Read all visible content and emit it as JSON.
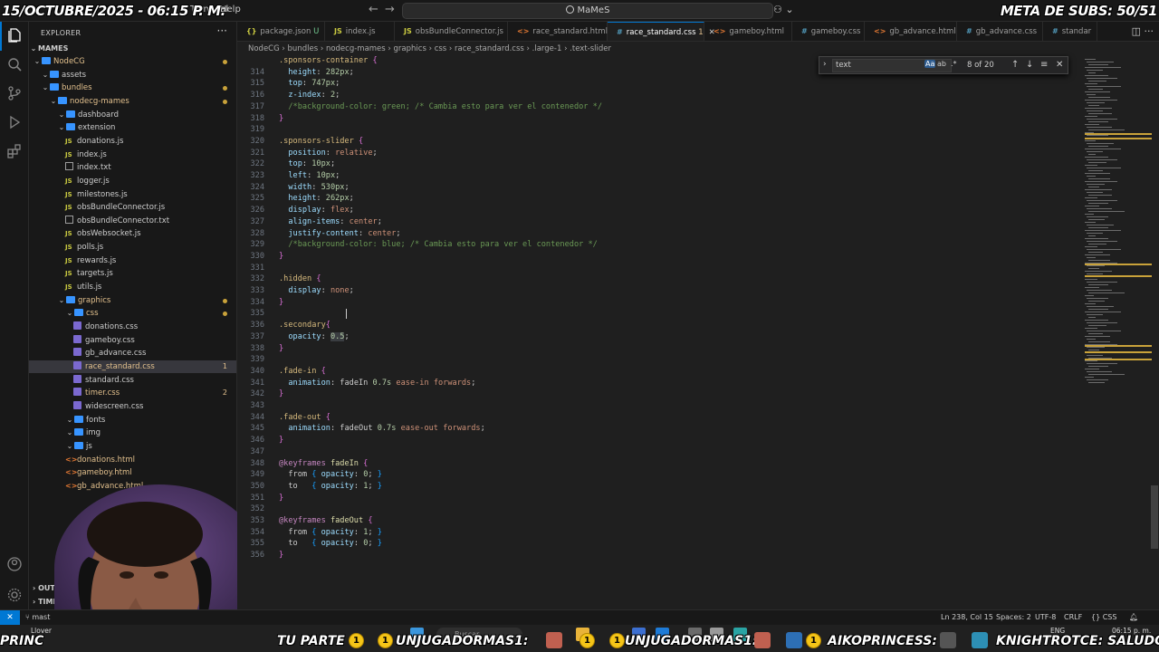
{
  "overlay": {
    "date": "15/OCTUBRE/2025 - 06:15 P. M.",
    "goal": "META DE SUBS: 50/51"
  },
  "menubar": {
    "terminal": "Terminal",
    "help": "Help"
  },
  "command_center": {
    "text": "MaMeS"
  },
  "sidebar": {
    "title": "EXPLORER",
    "section": "MAMES",
    "items": [
      {
        "label": "NodeCG",
        "type": "folder",
        "indent": 0
      },
      {
        "label": "assets",
        "type": "folder",
        "indent": 1
      },
      {
        "label": "bundles",
        "type": "folder",
        "indent": 1
      },
      {
        "label": "nodecg-mames",
        "type": "folder",
        "indent": 2
      },
      {
        "label": "dashboard",
        "type": "folder",
        "indent": 3
      },
      {
        "label": "extension",
        "type": "folder",
        "indent": 3
      },
      {
        "label": "donations.js",
        "type": "js",
        "indent": 4
      },
      {
        "label": "index.js",
        "type": "js",
        "indent": 4
      },
      {
        "label": "index.txt",
        "type": "txt",
        "indent": 4
      },
      {
        "label": "logger.js",
        "type": "js",
        "indent": 4
      },
      {
        "label": "milestones.js",
        "type": "js",
        "indent": 4
      },
      {
        "label": "obsBundleConnector.js",
        "type": "js",
        "indent": 4
      },
      {
        "label": "obsBundleConnector.txt",
        "type": "txt",
        "indent": 4
      },
      {
        "label": "obsWebsocket.js",
        "type": "js",
        "indent": 4
      },
      {
        "label": "polls.js",
        "type": "js",
        "indent": 4
      },
      {
        "label": "rewards.js",
        "type": "js",
        "indent": 4
      },
      {
        "label": "targets.js",
        "type": "js",
        "indent": 4
      },
      {
        "label": "utils.js",
        "type": "js",
        "indent": 4
      },
      {
        "label": "graphics",
        "type": "folder",
        "indent": 3
      },
      {
        "label": "css",
        "type": "folder",
        "indent": 4
      },
      {
        "label": "donations.css",
        "type": "css",
        "indent": 5
      },
      {
        "label": "gameboy.css",
        "type": "css",
        "indent": 5
      },
      {
        "label": "gb_advance.css",
        "type": "css",
        "indent": 5
      },
      {
        "label": "race_standard.css",
        "type": "css",
        "indent": 5,
        "badge": "1"
      },
      {
        "label": "standard.css",
        "type": "css",
        "indent": 5
      },
      {
        "label": "timer.css",
        "type": "css",
        "indent": 5,
        "badge": "2"
      },
      {
        "label": "widescreen.css",
        "type": "css",
        "indent": 5
      },
      {
        "label": "fonts",
        "type": "folder",
        "indent": 4
      },
      {
        "label": "img",
        "type": "folder",
        "indent": 4
      },
      {
        "label": "js",
        "type": "folder",
        "indent": 4
      },
      {
        "label": "donations.html",
        "type": "html",
        "indent": 4
      },
      {
        "label": "gameboy.html",
        "type": "html",
        "indent": 4
      },
      {
        "label": "gb_advance.html",
        "type": "html",
        "indent": 4
      }
    ],
    "outline": "OUTLINE",
    "timeline": "TIMELINE"
  },
  "tabs": [
    {
      "label": "package.json",
      "icon": "json",
      "suffix": "U"
    },
    {
      "label": "index.js",
      "icon": "js"
    },
    {
      "label": "obsBundleConnector.js",
      "icon": "js"
    },
    {
      "label": "race_standard.html",
      "icon": "html"
    },
    {
      "label": "race_standard.css",
      "icon": "css",
      "suffix": "1",
      "active": true
    },
    {
      "label": "gameboy.html",
      "icon": "html"
    },
    {
      "label": "gameboy.css",
      "icon": "css"
    },
    {
      "label": "gb_advance.html",
      "icon": "html"
    },
    {
      "label": "gb_advance.css",
      "icon": "css"
    },
    {
      "label": "standar",
      "icon": "css"
    }
  ],
  "breadcrumb": [
    "NodeCG",
    "bundles",
    "nodecg-mames",
    "graphics",
    "css",
    "race_standard.css",
    ".large-1",
    ".text-slider"
  ],
  "find_widget": {
    "query": "text",
    "count": "8 of 20"
  },
  "code_lines": [
    {
      "n": "314",
      "text": "  height: 282px;"
    },
    {
      "n": "315",
      "text": "  top: 747px;"
    },
    {
      "n": "316",
      "text": "  z-index: 2;"
    },
    {
      "n": "317",
      "text": "  /*background-color: green; /* Cambia esto para ver el contenedor */"
    },
    {
      "n": "318",
      "text": "}"
    },
    {
      "n": "319",
      "text": ""
    },
    {
      "n": "320",
      "text": ".sponsors-slider {"
    },
    {
      "n": "321",
      "text": "  position: relative;"
    },
    {
      "n": "322",
      "text": "  top: 10px;"
    },
    {
      "n": "323",
      "text": "  left: 10px;"
    },
    {
      "n": "324",
      "text": "  width: 530px;"
    },
    {
      "n": "325",
      "text": "  height: 262px;"
    },
    {
      "n": "326",
      "text": "  display: flex;"
    },
    {
      "n": "327",
      "text": "  align-items: center;"
    },
    {
      "n": "328",
      "text": "  justify-content: center;"
    },
    {
      "n": "329",
      "text": "  /*background-color: blue; /* Cambia esto para ver el contenedor */"
    },
    {
      "n": "330",
      "text": "}"
    },
    {
      "n": "331",
      "text": ""
    },
    {
      "n": "332",
      "text": ".hidden {"
    },
    {
      "n": "333",
      "text": "  display: none;"
    },
    {
      "n": "334",
      "text": "}"
    },
    {
      "n": "335",
      "text": ""
    },
    {
      "n": "336",
      "text": ".secondary{"
    },
    {
      "n": "337",
      "text": "  opacity: 0.5;"
    },
    {
      "n": "338",
      "text": "}"
    },
    {
      "n": "339",
      "text": ""
    },
    {
      "n": "340",
      "text": ".fade-in {"
    },
    {
      "n": "341",
      "text": "  animation: fadeIn 0.7s ease-in forwards;"
    },
    {
      "n": "342",
      "text": "}"
    },
    {
      "n": "343",
      "text": ""
    },
    {
      "n": "344",
      "text": ".fade-out {"
    },
    {
      "n": "345",
      "text": "  animation: fadeOut 0.7s ease-out forwards;"
    },
    {
      "n": "346",
      "text": "}"
    },
    {
      "n": "347",
      "text": ""
    },
    {
      "n": "348",
      "text": "@keyframes fadeIn {"
    },
    {
      "n": "349",
      "text": "  from { opacity: 0; }"
    },
    {
      "n": "350",
      "text": "  to   { opacity: 1; }"
    },
    {
      "n": "351",
      "text": "}"
    },
    {
      "n": "352",
      "text": ""
    },
    {
      "n": "353",
      "text": "@keyframes fadeOut {"
    },
    {
      "n": "354",
      "text": "  from { opacity: 1; }"
    },
    {
      "n": "355",
      "text": "  to   { opacity: 0; }"
    },
    {
      "n": "356",
      "text": "}"
    }
  ],
  "first_line": {
    "n": "",
    "text": ".sponsors-container {"
  },
  "status": {
    "branch": "mast",
    "cursor": "Ln 238, Col 15",
    "spaces": "Spaces: 2",
    "encoding": "UTF-8",
    "eol": "CRLF",
    "language": "{} CSS"
  },
  "taskbar": {
    "search": "Buscar",
    "lang": "ENG",
    "clock": "06:15 p. m.",
    "ticker": [
      "PRINC",
      "TU PARTE",
      "UNJUGADORMAS1:",
      "UNJUGADORMAS1:",
      "AIKOPRINCESS:",
      "KNIGHTROTCE: SALUDOS"
    ],
    "weather": "Llover"
  },
  "colors": {
    "accent": "#0078d4",
    "editor_bg": "#1f1f1f",
    "sidebar_bg": "#181818"
  }
}
